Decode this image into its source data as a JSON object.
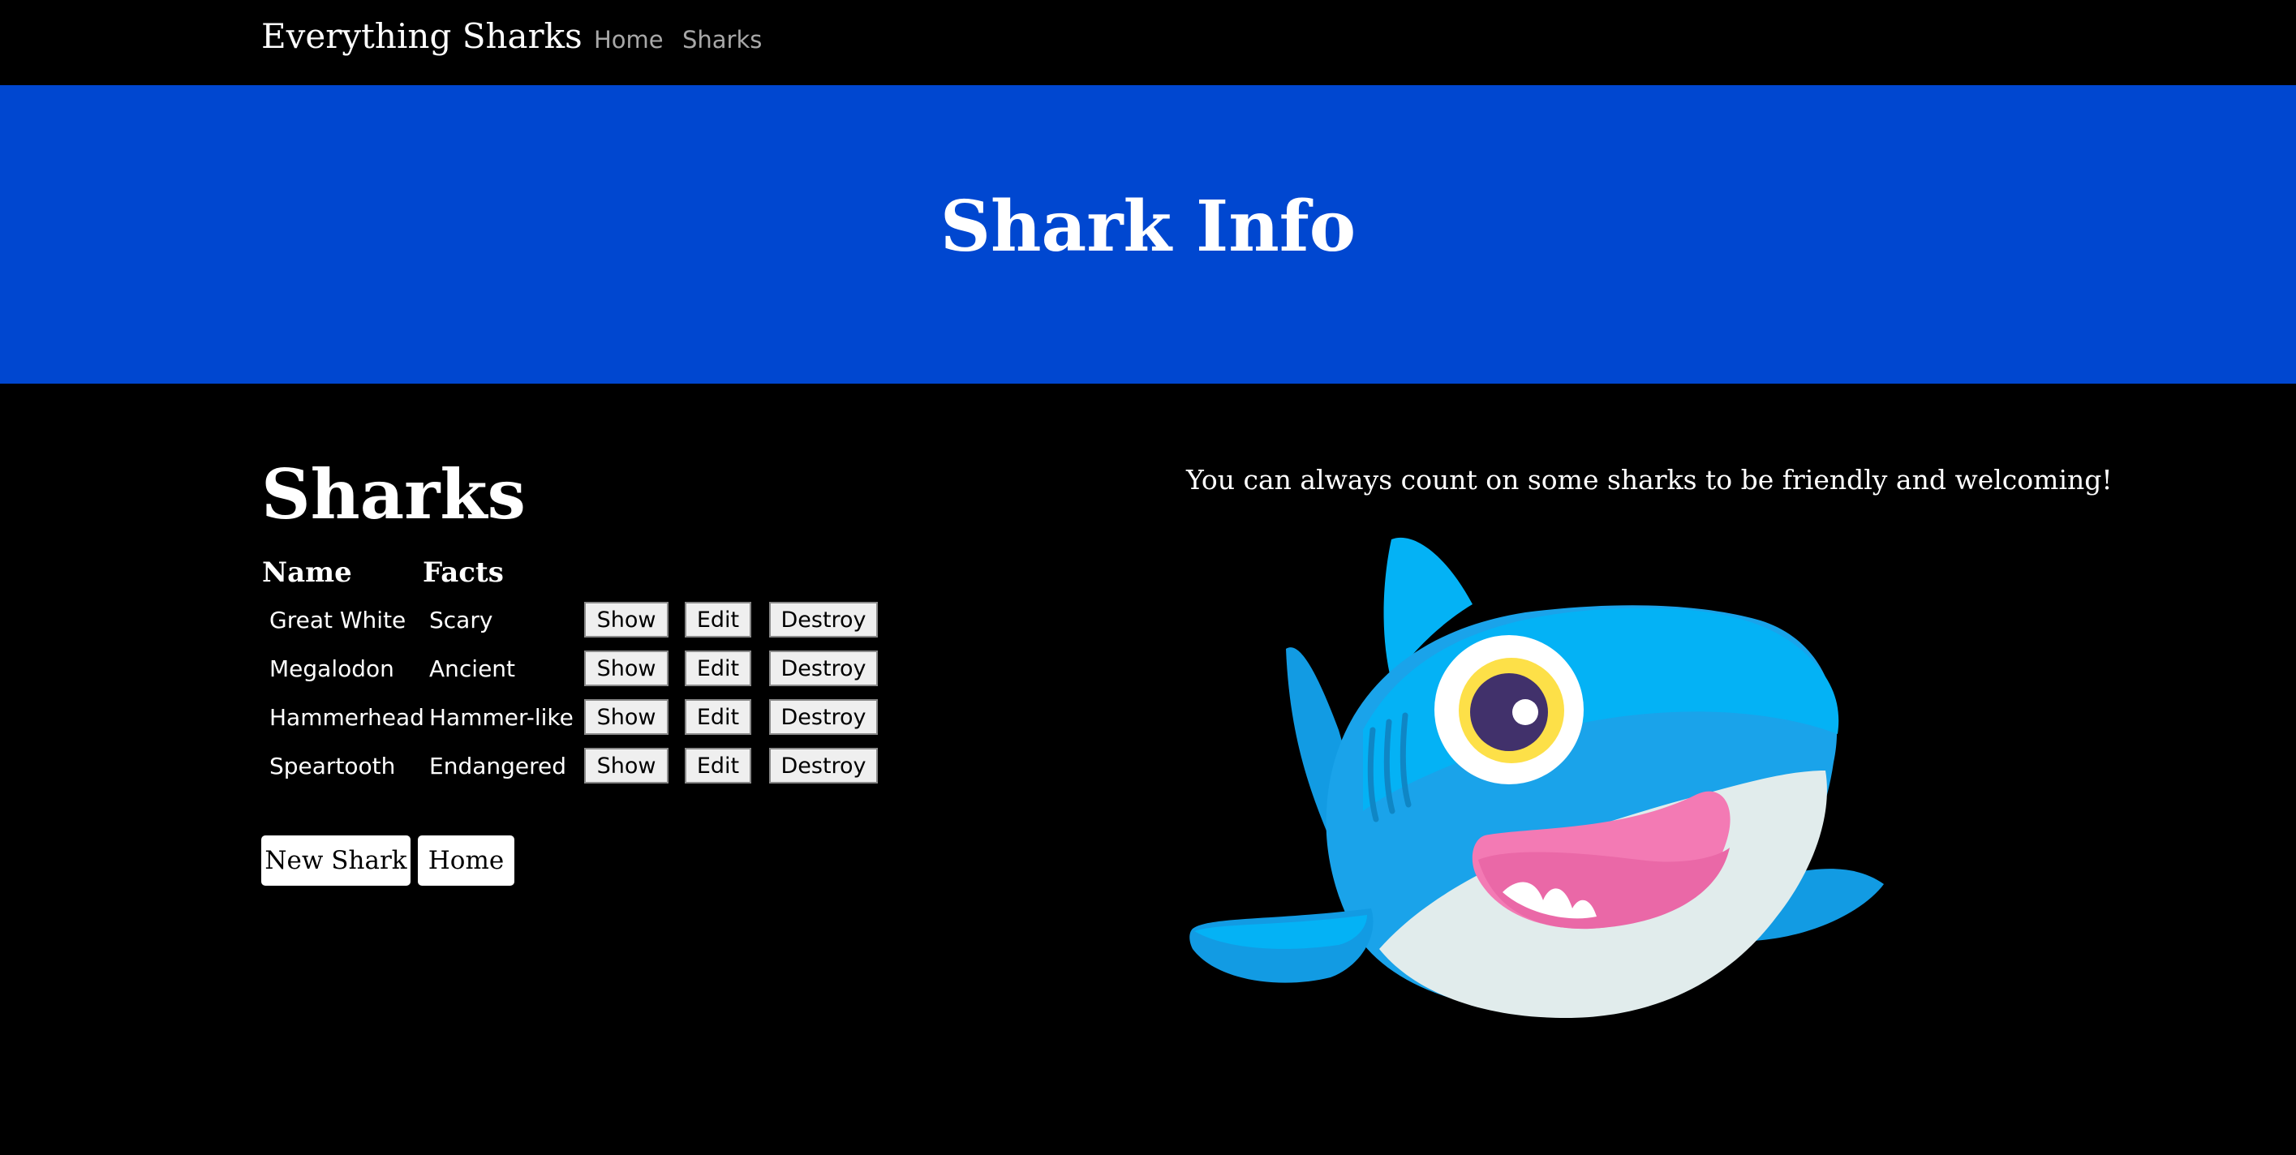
{
  "navbar": {
    "brand": "Everything Sharks",
    "links": [
      "Home",
      "Sharks"
    ]
  },
  "hero": {
    "title": "Shark Info"
  },
  "main": {
    "heading": "Sharks",
    "columns": [
      "Name",
      "Facts"
    ],
    "rows": [
      {
        "name": "Great White",
        "fact": "Scary"
      },
      {
        "name": "Megalodon",
        "fact": "Ancient"
      },
      {
        "name": "Hammerhead",
        "fact": "Hammer-like"
      },
      {
        "name": "Speartooth",
        "fact": "Endangered"
      }
    ],
    "row_actions": {
      "show": "Show",
      "edit": "Edit",
      "destroy": "Destroy"
    },
    "actions": {
      "new_shark": "New Shark",
      "home": "Home"
    }
  },
  "aside": {
    "tagline": "You can always count on some sharks to be friendly and welcoming!",
    "image_icon": "cartoon-shark-illustration"
  },
  "colors": {
    "hero_bg": "#0047d0",
    "page_bg": "#000000",
    "nav_link": "#a8a8a8",
    "shark_body": "#1aa3ea",
    "shark_belly": "#e1ecec",
    "shark_mouth": "#f37ab4"
  }
}
